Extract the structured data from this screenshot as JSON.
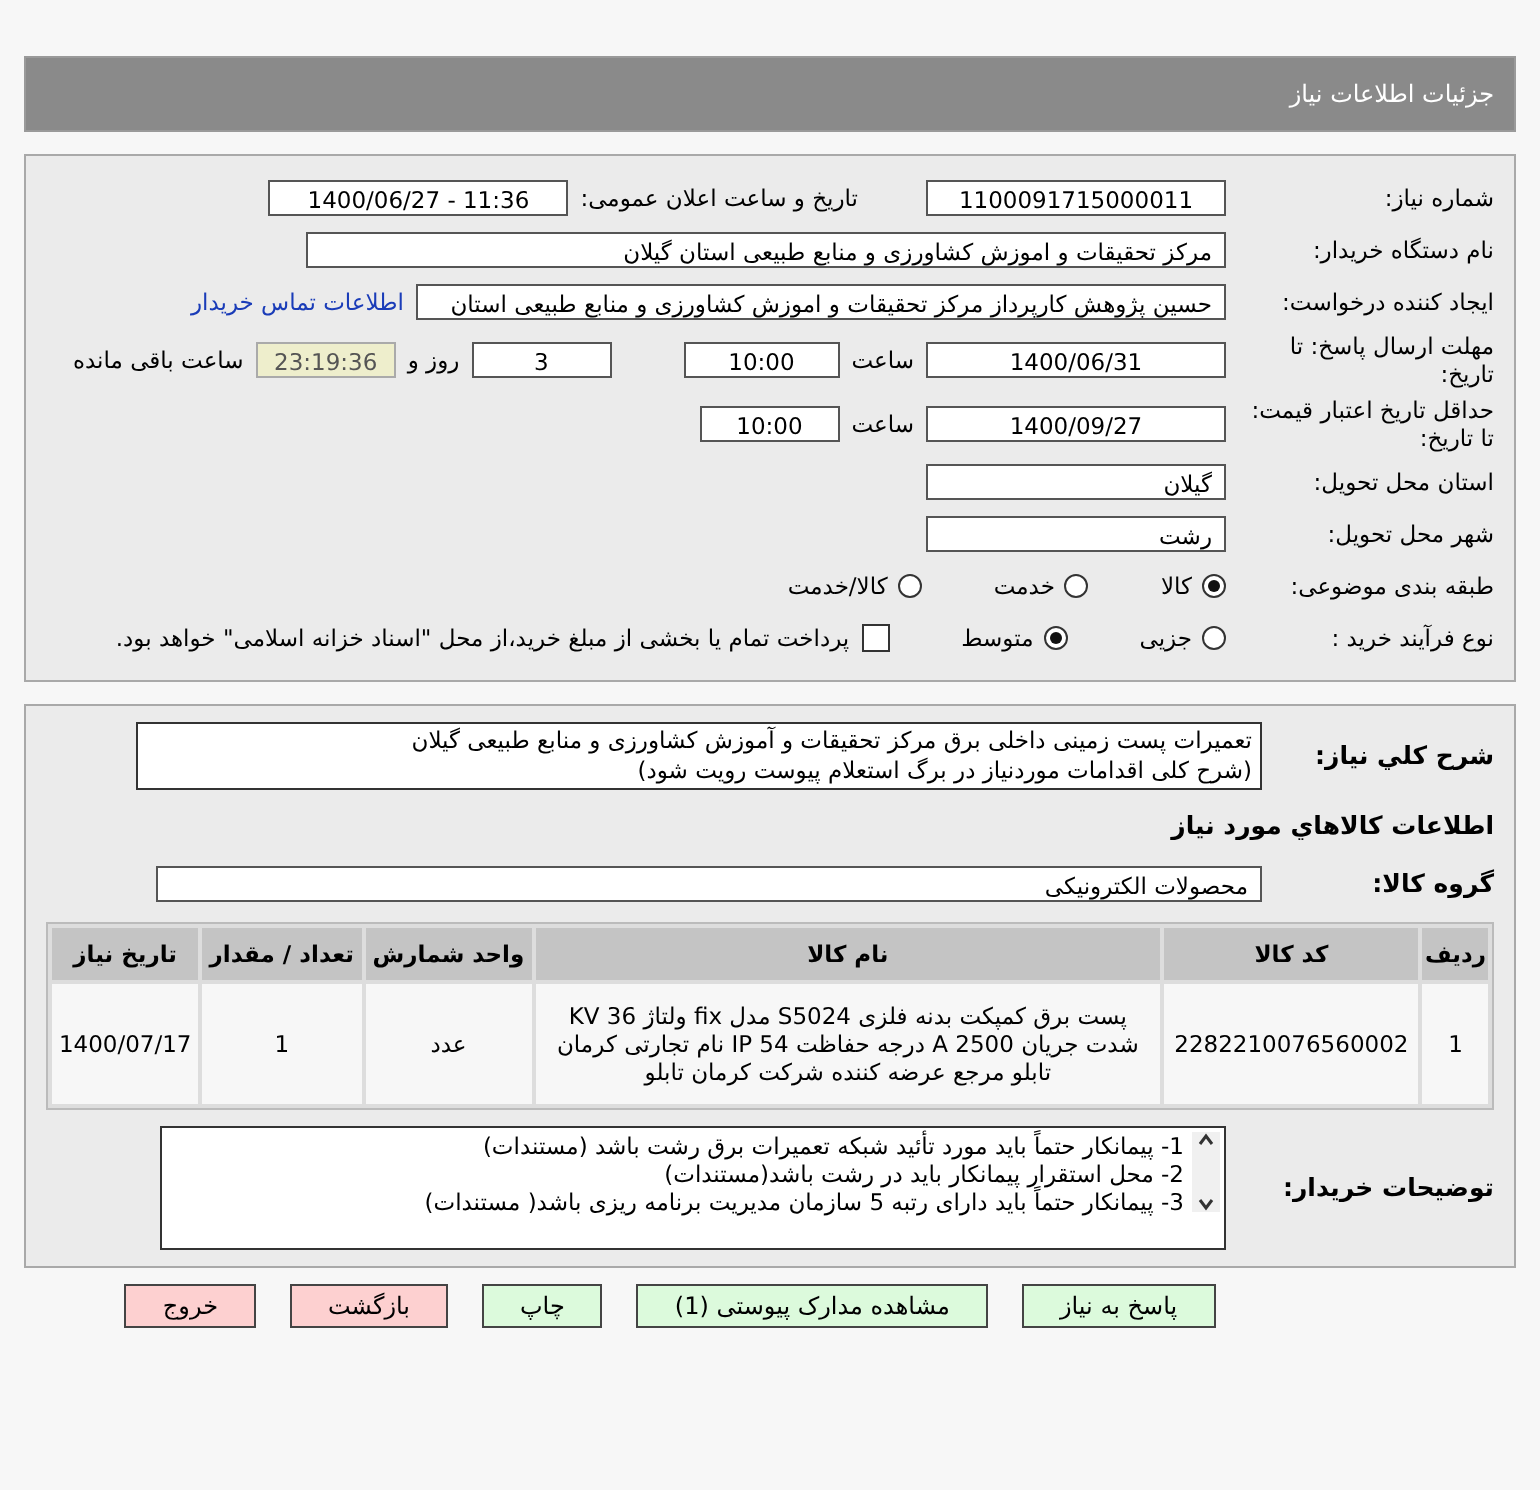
{
  "title": "جزئیات اطلاعات نیاز",
  "need_number": {
    "label": "شماره نیاز:",
    "value": "1100091715000011"
  },
  "announce": {
    "label": "تاریخ و ساعت اعلان عمومی:",
    "value": "1400/06/27 - 11:36"
  },
  "buyer": {
    "label": "نام دستگاه خریدار:",
    "value": "مرکز تحقیقات و اموزش کشاورزی و منابع طبیعی استان گیلان"
  },
  "requester": {
    "label": "ایجاد کننده درخواست:",
    "value": "حسین پژوهش کارپرداز مرکز تحقیقات و اموزش کشاورزی و منابع طبیعی استان",
    "link": "اطلاعات تماس خریدار"
  },
  "deadline": {
    "label": "مهلت ارسال پاسخ: تا تاریخ:",
    "date": "1400/06/31",
    "time_label": "ساعت",
    "time": "10:00",
    "days": "3",
    "days_label": "روز و",
    "remaining": "23:19:36",
    "remaining_label": "ساعت باقی مانده"
  },
  "validity": {
    "label": "حداقل تاریخ اعتبار قیمت: تا تاریخ:",
    "date": "1400/09/27",
    "time_label": "ساعت",
    "time": "10:00"
  },
  "province": {
    "label": "استان محل تحویل:",
    "value": "گیلان"
  },
  "city": {
    "label": "شهر محل تحویل:",
    "value": "رشت"
  },
  "category": {
    "label": "طبقه بندی موضوعی:",
    "options": [
      {
        "label": "کالا",
        "selected": true
      },
      {
        "label": "خدمت",
        "selected": false
      },
      {
        "label": "کالا/خدمت",
        "selected": false
      }
    ]
  },
  "process": {
    "label": "نوع فرآیند خرید :",
    "options": [
      {
        "label": "جزیی",
        "selected": false
      },
      {
        "label": "متوسط",
        "selected": true
      }
    ],
    "payment": {
      "checked": false,
      "label": "پرداخت تمام یا بخشی از مبلغ خرید،از محل \"اسناد خزانه اسلامی\" خواهد بود."
    }
  },
  "description": {
    "label": "شرح کلي نياز:",
    "lines": [
      "تعمیرات پست زمینی داخلی برق مرکز تحقیقات و آموزش کشاورزی و منابع طبیعی گیلان",
      "(شرح کلی اقدامات موردنیاز در برگ استعلام پیوست رویت شود)"
    ]
  },
  "goods_heading": "اطلاعات كالاهاي مورد نياز",
  "goods_group": {
    "label": "گروه کالا:",
    "value": "محصولات الکترونیکی"
  },
  "table": {
    "columns": [
      "ردیف",
      "کد کالا",
      "نام کالا",
      "واحد شمارش",
      "تعداد / مقدار",
      "تاریخ نیاز"
    ],
    "rows": [
      [
        "1",
        "2282210076560002",
        "پست برق کمپکت بدنه فلزی S5024 مدل fix ولتاژ 36 KV شدت جریان 2500 A درجه حفاظت IP 54 نام تجارتی کرمان تابلو مرجع عرضه کننده شرکت کرمان تابلو",
        "عدد",
        "1",
        "1400/07/17"
      ]
    ]
  },
  "buyer_notes": {
    "label": "توضیحات خریدار:",
    "lines": [
      "1- پیمانکار حتماً باید مورد تأئید شبکه تعمیرات برق رشت باشد (مستندات)",
      "2- محل استقرار پیمانکار باید در رشت باشد(مستندات)",
      "3- پیمانکار حتماً باید دارای رتبه 5 سازمان مدیریت برنامه ریزی باشد( مستندات)"
    ]
  },
  "buttons": [
    {
      "label": "پاسخ به نیاز",
      "kind": "primary"
    },
    {
      "label": "مشاهده مدارک پیوستی (1)",
      "kind": "primary"
    },
    {
      "label": "چاپ",
      "kind": "primary"
    },
    {
      "label": "بازگشت",
      "kind": "danger"
    },
    {
      "label": "خروج",
      "kind": "danger"
    }
  ]
}
